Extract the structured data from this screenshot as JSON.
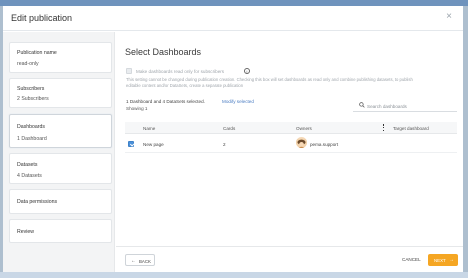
{
  "modal": {
    "title": "Edit publication",
    "close_glyph": "×"
  },
  "steps": [
    {
      "title": "Publication name",
      "subtitle": "read-only"
    },
    {
      "title": "Subscribers",
      "subtitle": "2 Subscribers"
    },
    {
      "title": "Dashboards",
      "subtitle": "1 Dashboard"
    },
    {
      "title": "Datasets",
      "subtitle": "4 Datasets"
    },
    {
      "title": "Data permissions",
      "subtitle": ""
    },
    {
      "title": "Review",
      "subtitle": ""
    }
  ],
  "section": {
    "title": "Select Dashboards",
    "readonly_checkbox_label": "Make dashboards read only for subscribers",
    "description_line1": "This setting cannot be changed during publication creation. Checking this box will set dashboards as read only and combine publishing datasets, to publish",
    "description_line2": "editable content and/or DataSets, create a separate publication",
    "selection_summary": "1 Dashboard and 4 DataSets selected.",
    "modify_link": "Modify selected",
    "showing": "Showing 1"
  },
  "search": {
    "placeholder": "Search dashboards"
  },
  "table": {
    "columns": [
      "Name",
      "Cards",
      "Owners",
      "Target dashboard"
    ],
    "rows": [
      {
        "name": "New page",
        "cards": "2",
        "owner": "pema.support",
        "checked": true
      }
    ]
  },
  "footer": {
    "back_label": "BACK",
    "back_arrow": "←",
    "cancel_label": "CANCEL",
    "next_label": "NEXT",
    "next_arrow": "→"
  },
  "colors": {
    "accent": "#f5a623",
    "link": "#4a7cc2",
    "checkbox": "#4a90d9",
    "backdrop": "#aebfcf"
  }
}
